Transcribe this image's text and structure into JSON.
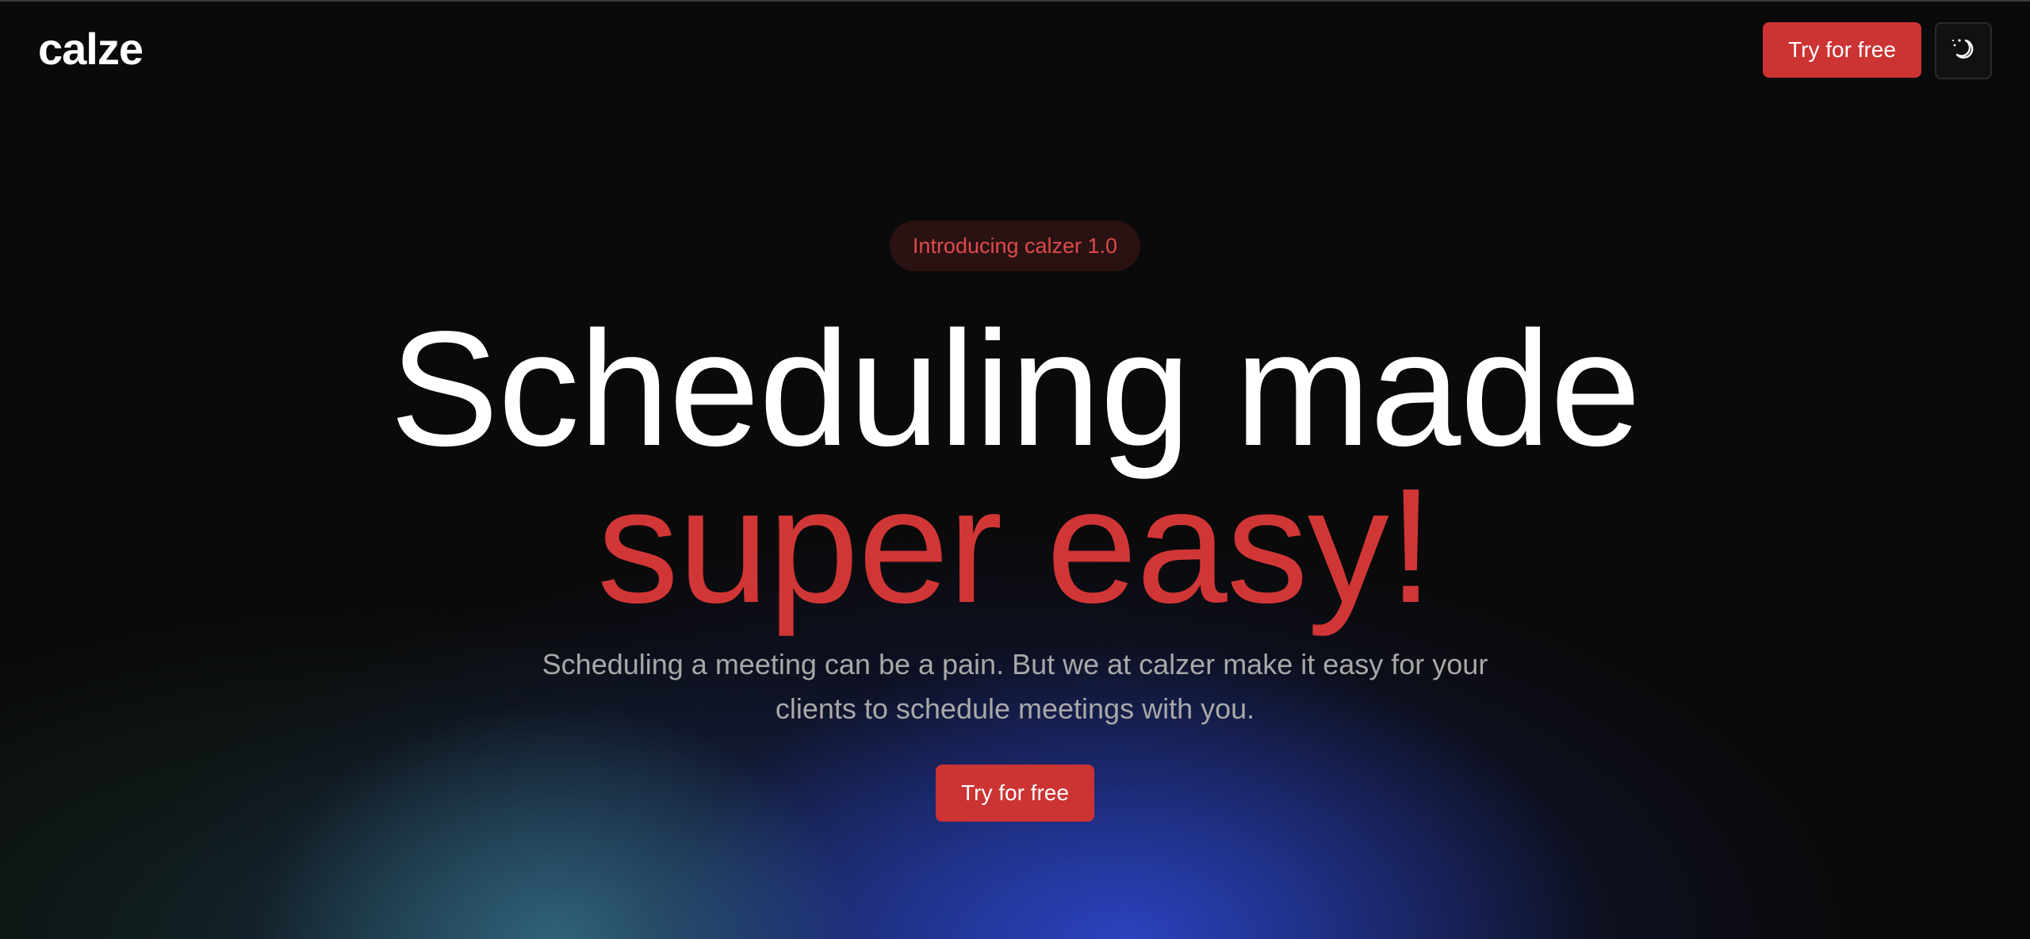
{
  "header": {
    "logo": "calze",
    "cta_label": "Try for free",
    "theme_toggle_icon": "moon-stars-icon"
  },
  "hero": {
    "badge": "Introducing calzer 1.0",
    "headline_line1": "Scheduling made",
    "headline_line2": "super easy!",
    "subtitle": "Scheduling a meeting can be a pain. But we at calzer make it easy for your clients to schedule meetings with you.",
    "cta_label": "Try for free"
  },
  "colors": {
    "background": "#0a0a0a",
    "accent": "#cc3333",
    "headline_accent": "#d13636",
    "subtitle": "#a8a8a8"
  }
}
